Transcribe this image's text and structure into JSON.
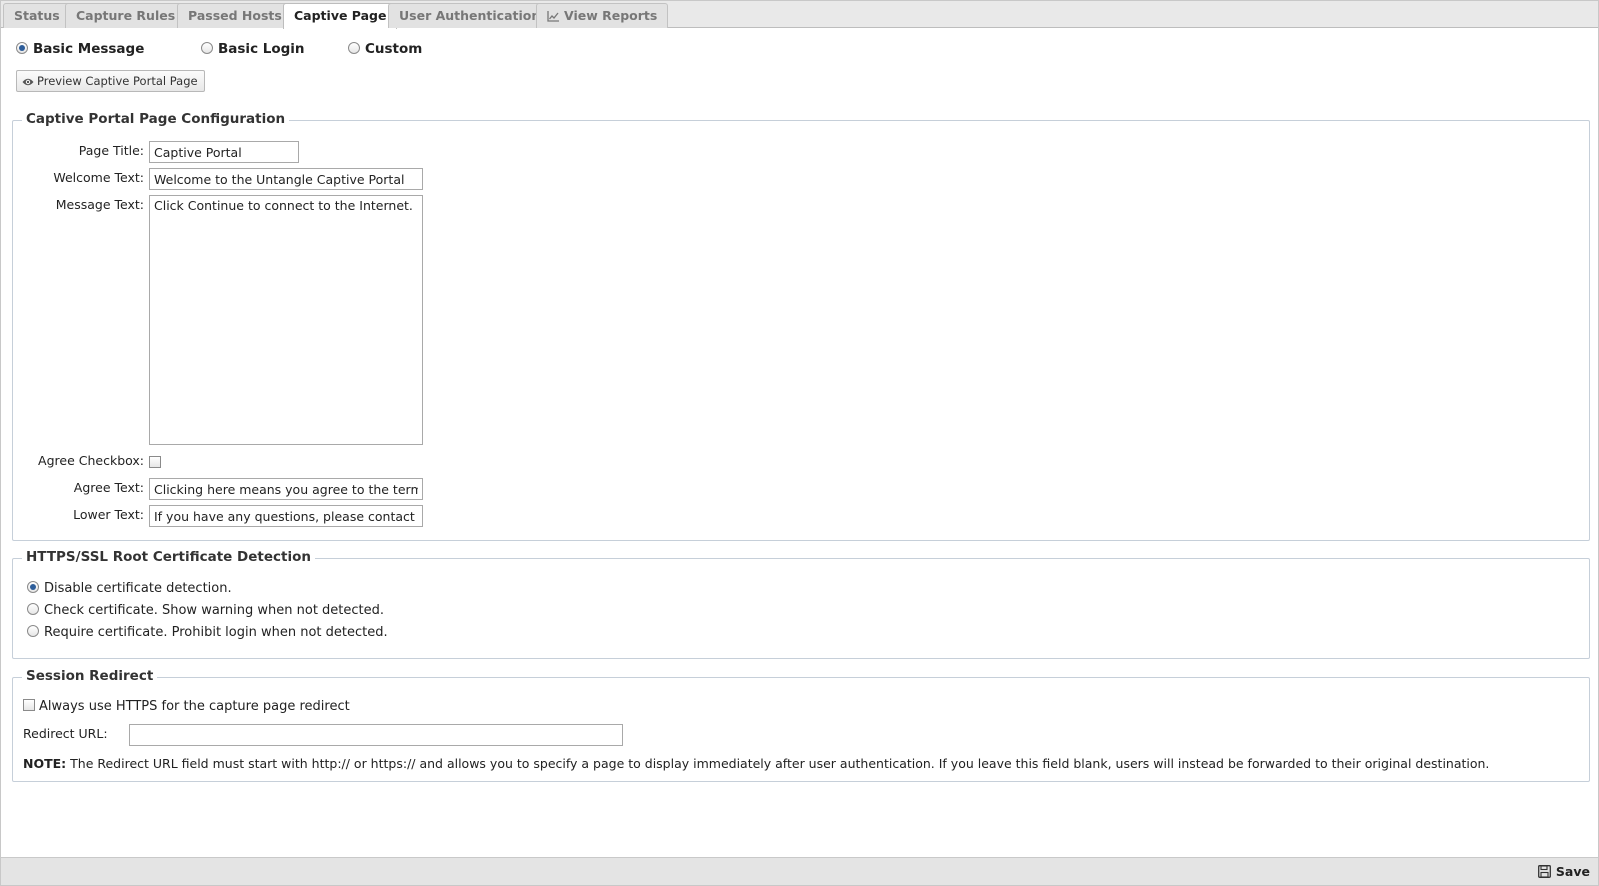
{
  "tabs": [
    {
      "label": "Status",
      "active": false
    },
    {
      "label": "Capture Rules",
      "active": false
    },
    {
      "label": "Passed Hosts",
      "active": false
    },
    {
      "label": "Captive Page",
      "active": true
    },
    {
      "label": "User Authentication",
      "active": false
    },
    {
      "label": "View Reports",
      "active": false,
      "icon": "line-chart-icon"
    }
  ],
  "page_type": {
    "options": [
      "Basic Message",
      "Basic Login",
      "Custom"
    ],
    "selected": "Basic Message"
  },
  "preview_button": {
    "label": "Preview Captive Portal Page",
    "icon": "eye-icon"
  },
  "config": {
    "legend": "Captive Portal Page Configuration",
    "page_title_label": "Page Title:",
    "page_title_value": "Captive Portal",
    "welcome_text_label": "Welcome Text:",
    "welcome_text_value": "Welcome to the Untangle Captive Portal",
    "message_text_label": "Message Text:",
    "message_text_value": "Click Continue to connect to the Internet.",
    "agree_checkbox_label": "Agree Checkbox:",
    "agree_checkbox_checked": false,
    "agree_text_label": "Agree Text:",
    "agree_text_value": "Clicking here means you agree to the terms above.",
    "lower_text_label": "Lower Text:",
    "lower_text_value": "If you have any questions, please contact your network administrator."
  },
  "cert_detection": {
    "legend": "HTTPS/SSL Root Certificate Detection",
    "options": [
      "Disable certificate detection.",
      "Check certificate. Show warning when not detected.",
      "Require certificate. Prohibit login when not detected."
    ],
    "selected_index": 0
  },
  "session_redirect": {
    "legend": "Session Redirect",
    "always_https_label": "Always use HTTPS for the capture page redirect",
    "always_https_checked": false,
    "redirect_url_label": "Redirect URL:",
    "redirect_url_value": "",
    "note_prefix": "NOTE:",
    "note_text": " The Redirect URL field must start with http:// or https:// and allows you to specify a page to display immediately after user authentication. If you leave this field blank, users will instead be forwarded to their original destination."
  },
  "footer": {
    "save_label": "Save",
    "save_icon": "floppy-disk-icon"
  },
  "colors": {
    "accent": "#2d5d9a",
    "tabbar_bg": "#e9e9e9",
    "fieldset_border": "#c6cfd9"
  }
}
